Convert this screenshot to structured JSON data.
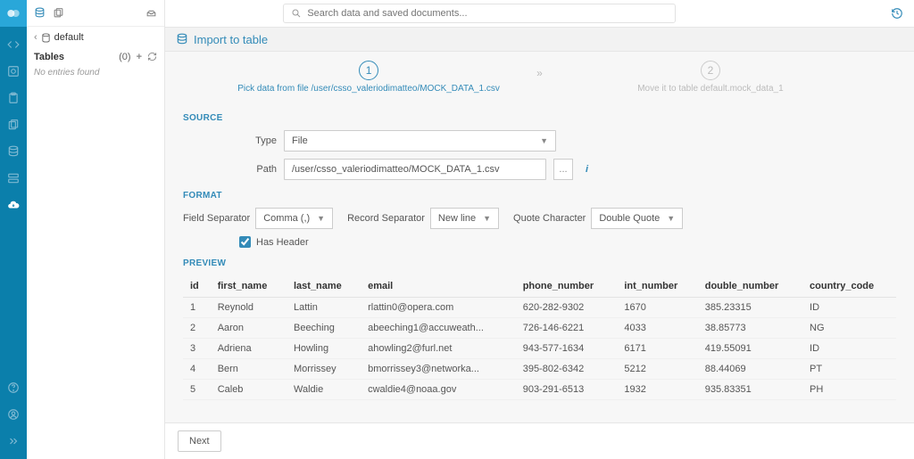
{
  "search": {
    "placeholder": "Search data and saved documents..."
  },
  "left_panel": {
    "breadcrumb": "default",
    "tables_label": "Tables",
    "tables_count": "(0)",
    "empty_text": "No entries found"
  },
  "title": "Import to table",
  "steps": {
    "s1": {
      "num": "1",
      "label": "Pick data from file /user/csso_valeriodimatteo/MOCK_DATA_1.csv"
    },
    "s2": {
      "num": "2",
      "label": "Move it to table default.mock_data_1"
    }
  },
  "source": {
    "heading": "SOURCE",
    "type_label": "Type",
    "type_value": "File",
    "path_label": "Path",
    "path_value": "/user/csso_valeriodimatteo/MOCK_DATA_1.csv",
    "file_browse": "..."
  },
  "format": {
    "heading": "FORMAT",
    "field_sep_label": "Field Separator",
    "field_sep_value": "Comma (,)",
    "record_sep_label": "Record Separator",
    "record_sep_value": "New line",
    "quote_label": "Quote Character",
    "quote_value": "Double Quote",
    "has_header_label": "Has Header"
  },
  "preview": {
    "heading": "PREVIEW",
    "columns": [
      "id",
      "first_name",
      "last_name",
      "email",
      "phone_number",
      "int_number",
      "double_number",
      "country_code"
    ],
    "rows": [
      [
        "1",
        "Reynold",
        "Lattin",
        "rlattin0@opera.com",
        "620-282-9302",
        "1670",
        "385.23315",
        "ID"
      ],
      [
        "2",
        "Aaron",
        "Beeching",
        "abeeching1@accuweath...",
        "726-146-6221",
        "4033",
        "38.85773",
        "NG"
      ],
      [
        "3",
        "Adriena",
        "Howling",
        "ahowling2@furl.net",
        "943-577-1634",
        "6171",
        "419.55091",
        "ID"
      ],
      [
        "4",
        "Bern",
        "Morrissey",
        "bmorrissey3@networka...",
        "395-802-6342",
        "5212",
        "88.44069",
        "PT"
      ],
      [
        "5",
        "Caleb",
        "Waldie",
        "cwaldie4@noaa.gov",
        "903-291-6513",
        "1932",
        "935.83351",
        "PH"
      ]
    ]
  },
  "footer": {
    "next": "Next"
  }
}
